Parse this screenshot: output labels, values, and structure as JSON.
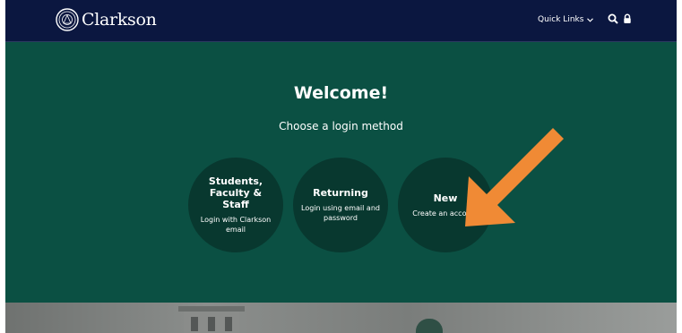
{
  "navbar": {
    "logo_text": "Clarkson",
    "quick_links_label": "Quick Links",
    "icons": [
      "search-icon",
      "lock-icon",
      "chevron-down-icon"
    ]
  },
  "hero": {
    "title": "Welcome!",
    "subtitle": "Choose a login method",
    "options": [
      {
        "title": "Students, Faculty & Staff",
        "description": "Login with Clarkson email"
      },
      {
        "title": "Returning",
        "description": "Login using email and password"
      },
      {
        "title": "New",
        "description": "Create an account"
      }
    ]
  },
  "colors": {
    "navbar_bg": "#0b1740",
    "hero_bg": "#0b5043",
    "circle_bg": "#08382f",
    "arrow": "#f08a35",
    "text": "#ffffff"
  }
}
